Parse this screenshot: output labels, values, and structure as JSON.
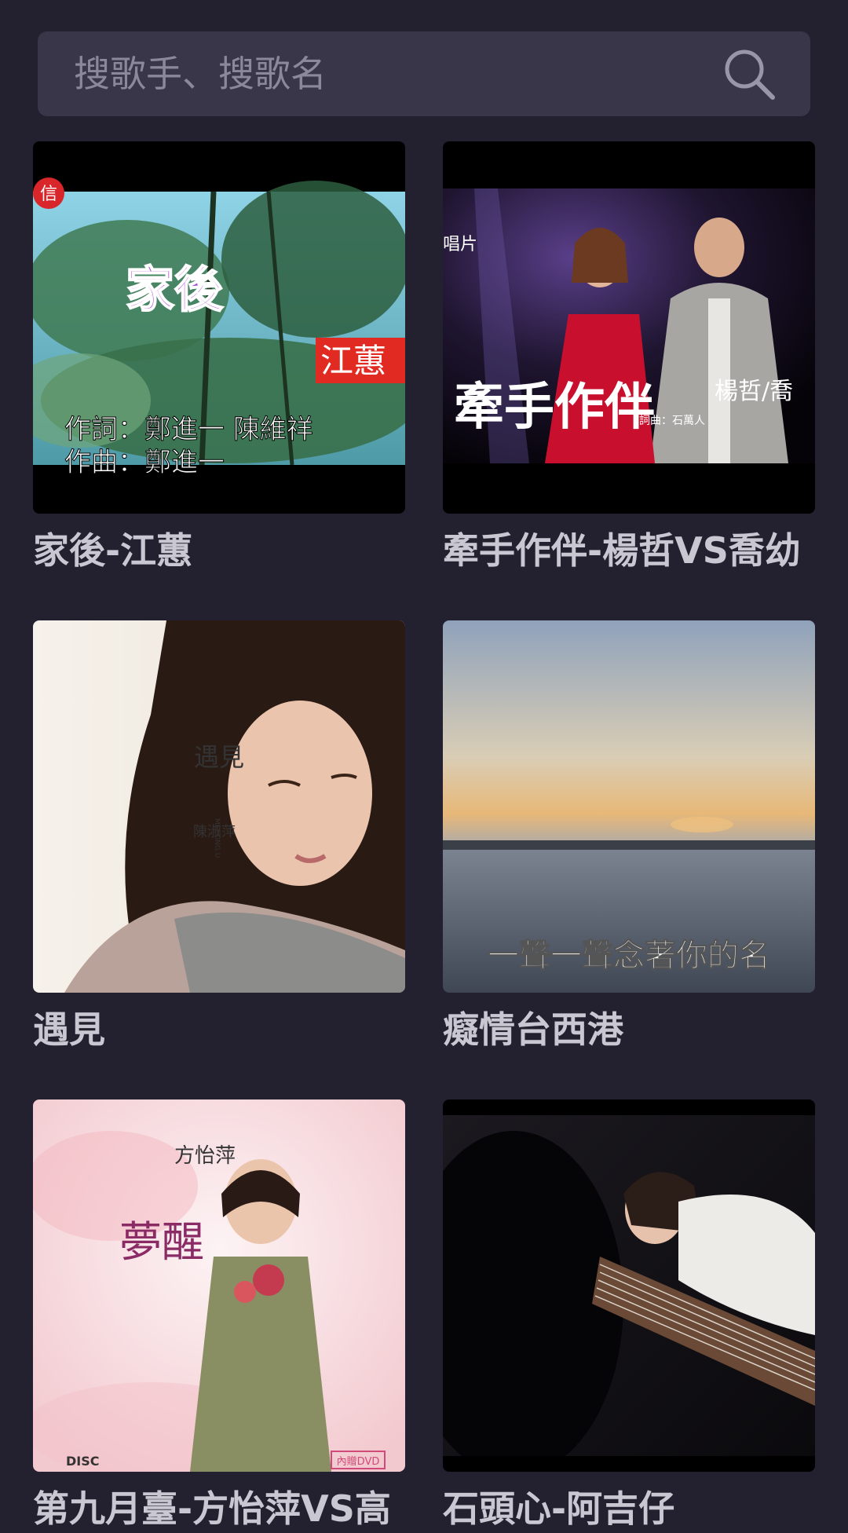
{
  "search": {
    "placeholder": "搜歌手、搜歌名"
  },
  "songs": [
    {
      "title": "家後-江蕙",
      "cover_text": {
        "song": "家後",
        "singer": "江蕙",
        "lyricist": "作詞：鄭進一 陳維祥",
        "composer": "作曲：鄭進一",
        "label_badge": "信"
      }
    },
    {
      "title": "牽手作伴-楊哲VS喬幼",
      "cover_text": {
        "song": "牽手作伴",
        "singer": "楊哲/喬",
        "credit": "詞曲：石萬人",
        "label": "唱片"
      }
    },
    {
      "title": "遇見",
      "cover_text": {
        "song": "遇見",
        "subtitle": "MEETING U",
        "singer": "陳淑萍"
      }
    },
    {
      "title": "癡情台西港",
      "cover_text": {
        "caption": "一聲一聲念著你的名"
      }
    },
    {
      "title": "第九月臺-方怡萍VS高",
      "cover_text": {
        "singer": "方怡萍",
        "album": "夢醒",
        "badge": "內贈DVD",
        "disc_logo": "DISC"
      }
    },
    {
      "title": "石頭心-阿吉仔",
      "cover_text": {}
    }
  ],
  "colors": {
    "background": "#23212f",
    "search_bg": "#383648",
    "title_text": "#c9c8d2",
    "placeholder": "#8a889a"
  }
}
